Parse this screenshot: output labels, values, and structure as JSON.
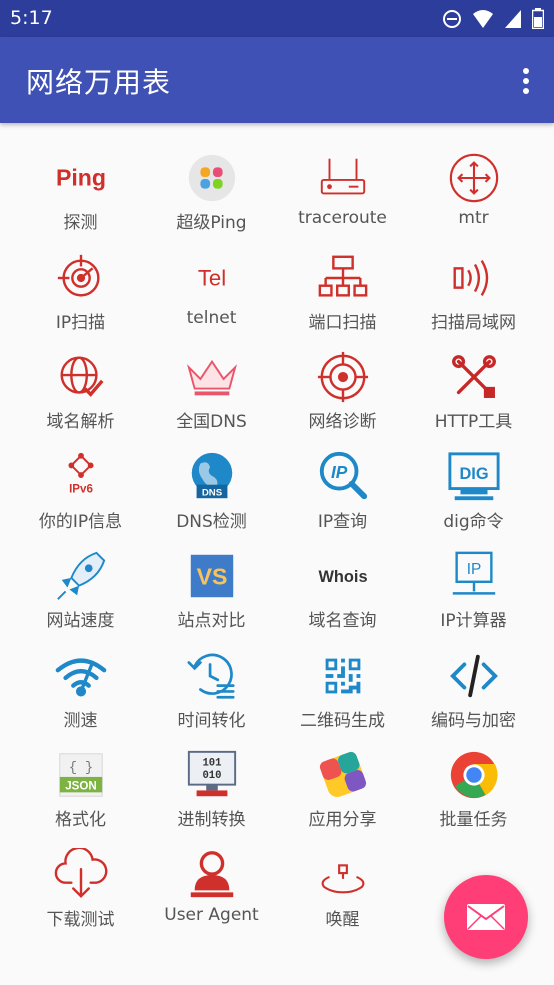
{
  "status": {
    "time": "5:17"
  },
  "appbar": {
    "title": "网络万用表"
  },
  "colors": {
    "appbar": "#3f51b5",
    "statusbar": "#2d3d9c",
    "red": "#d0302b",
    "blue": "#1e88c8",
    "fab": "#ff3d77"
  },
  "tools": [
    {
      "label": "探测",
      "icon": "ping-text-icon",
      "icon_text": "Ping"
    },
    {
      "label": "超级Ping",
      "icon": "super-ping-icon"
    },
    {
      "label": "traceroute",
      "icon": "router-icon"
    },
    {
      "label": "mtr",
      "icon": "compass-arrows-icon"
    },
    {
      "label": "IP扫描",
      "icon": "radar-icon"
    },
    {
      "label": "telnet",
      "icon": "telnet-text-icon",
      "icon_text": "Tel"
    },
    {
      "label": "端口扫描",
      "icon": "network-tree-icon"
    },
    {
      "label": "扫描局域网",
      "icon": "wireless-scan-icon"
    },
    {
      "label": "域名解析",
      "icon": "globe-check-icon"
    },
    {
      "label": "全国DNS",
      "icon": "crown-icon"
    },
    {
      "label": "网络诊断",
      "icon": "target-icon"
    },
    {
      "label": "HTTP工具",
      "icon": "tools-icon"
    },
    {
      "label": "你的IP信息",
      "icon": "ipv6-icon",
      "icon_text": "IPv6"
    },
    {
      "label": "DNS检测",
      "icon": "dns-globe-icon",
      "icon_text": "DNS"
    },
    {
      "label": "IP查询",
      "icon": "ip-search-icon",
      "icon_text": "IP"
    },
    {
      "label": "dig命令",
      "icon": "dig-monitor-icon",
      "icon_text": "DIG"
    },
    {
      "label": "网站速度",
      "icon": "rocket-icon"
    },
    {
      "label": "站点对比",
      "icon": "vs-icon",
      "icon_text": "VS"
    },
    {
      "label": "域名查询",
      "icon": "whois-icon",
      "icon_text": "Whois"
    },
    {
      "label": "IP计算器",
      "icon": "ip-monitor-icon",
      "icon_text": "IP"
    },
    {
      "label": "测速",
      "icon": "wifi-speed-icon"
    },
    {
      "label": "时间转化",
      "icon": "clock-history-icon"
    },
    {
      "label": "二维码生成",
      "icon": "qr-code-icon"
    },
    {
      "label": "编码与加密",
      "icon": "code-icon"
    },
    {
      "label": "格式化",
      "icon": "json-icon",
      "icon_text": "JSON",
      "icon_text2": "{ }"
    },
    {
      "label": "进制转换",
      "icon": "binary-monitor-icon",
      "icon_text": "101",
      "icon_text2": "010"
    },
    {
      "label": "应用分享",
      "icon": "share-app-icon"
    },
    {
      "label": "批量任务",
      "icon": "chrome-icon"
    },
    {
      "label": "下载测试",
      "icon": "cloud-download-icon"
    },
    {
      "label": "User Agent",
      "icon": "user-agent-icon"
    },
    {
      "label": "唤醒",
      "icon": "wake-icon"
    }
  ],
  "fab": {
    "icon": "mail-icon"
  }
}
